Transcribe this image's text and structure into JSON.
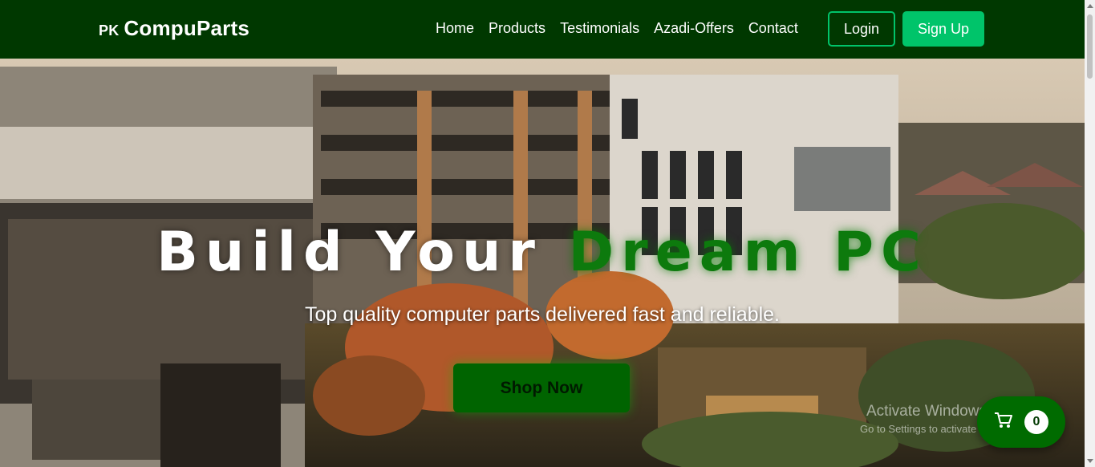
{
  "brand": {
    "flag": "PK",
    "name": "CompuParts"
  },
  "nav": {
    "links": [
      "Home",
      "Products",
      "Testimonials",
      "Azadi-Offers",
      "Contact"
    ],
    "login": "Login",
    "signup": "Sign Up"
  },
  "hero": {
    "title_white": "Build Your ",
    "title_accent": "Dream PC",
    "subtitle": "Top quality computer parts delivered fast and reliable.",
    "cta": "Shop Now"
  },
  "cart": {
    "icon": "cart-icon",
    "count": "0"
  },
  "watermark": {
    "line1": "Activate Windows",
    "line2": "Go to Settings to activate Windows."
  },
  "colors": {
    "nav_bg": "#003800",
    "accent_green": "#00c46a",
    "title_accent": "#0d7a0d",
    "cta_bg": "#006400",
    "cart_bg": "#006b00"
  }
}
